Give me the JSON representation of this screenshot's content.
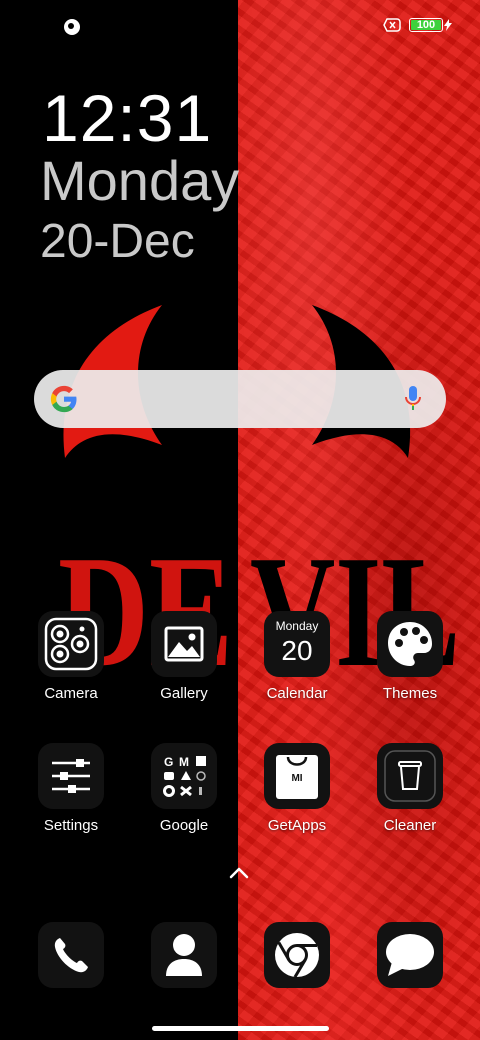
{
  "status_bar": {
    "battery_percent": "100",
    "battery_level": 1.0,
    "battery_color": "#3dd13d"
  },
  "lockscreen": {
    "time": "12:31",
    "day": "Monday",
    "date": "20-Dec"
  },
  "wallpaper": {
    "left_color": "#000000",
    "right_color": "#e1150f",
    "text": "DEVIL"
  },
  "search": {
    "mic_icon": "mic-icon",
    "logo_icon": "google-g-icon"
  },
  "apps": {
    "row1": [
      {
        "label": "Camera",
        "icon": "camera-icon"
      },
      {
        "label": "Gallery",
        "icon": "image-icon"
      },
      {
        "label": "Calendar",
        "icon": "calendar-icon",
        "month": "Monday",
        "day": "20"
      },
      {
        "label": "Themes",
        "icon": "palette-icon"
      }
    ],
    "row2": [
      {
        "label": "Settings",
        "icon": "sliders-icon"
      },
      {
        "label": "Google",
        "icon": "google-folder-icon"
      },
      {
        "label": "GetApps",
        "icon": "shopping-bag-icon",
        "badge": "MI"
      },
      {
        "label": "Cleaner",
        "icon": "trash-icon"
      }
    ]
  },
  "dock": [
    "phone-icon",
    "contacts-icon",
    "chrome-icon",
    "messages-icon"
  ]
}
